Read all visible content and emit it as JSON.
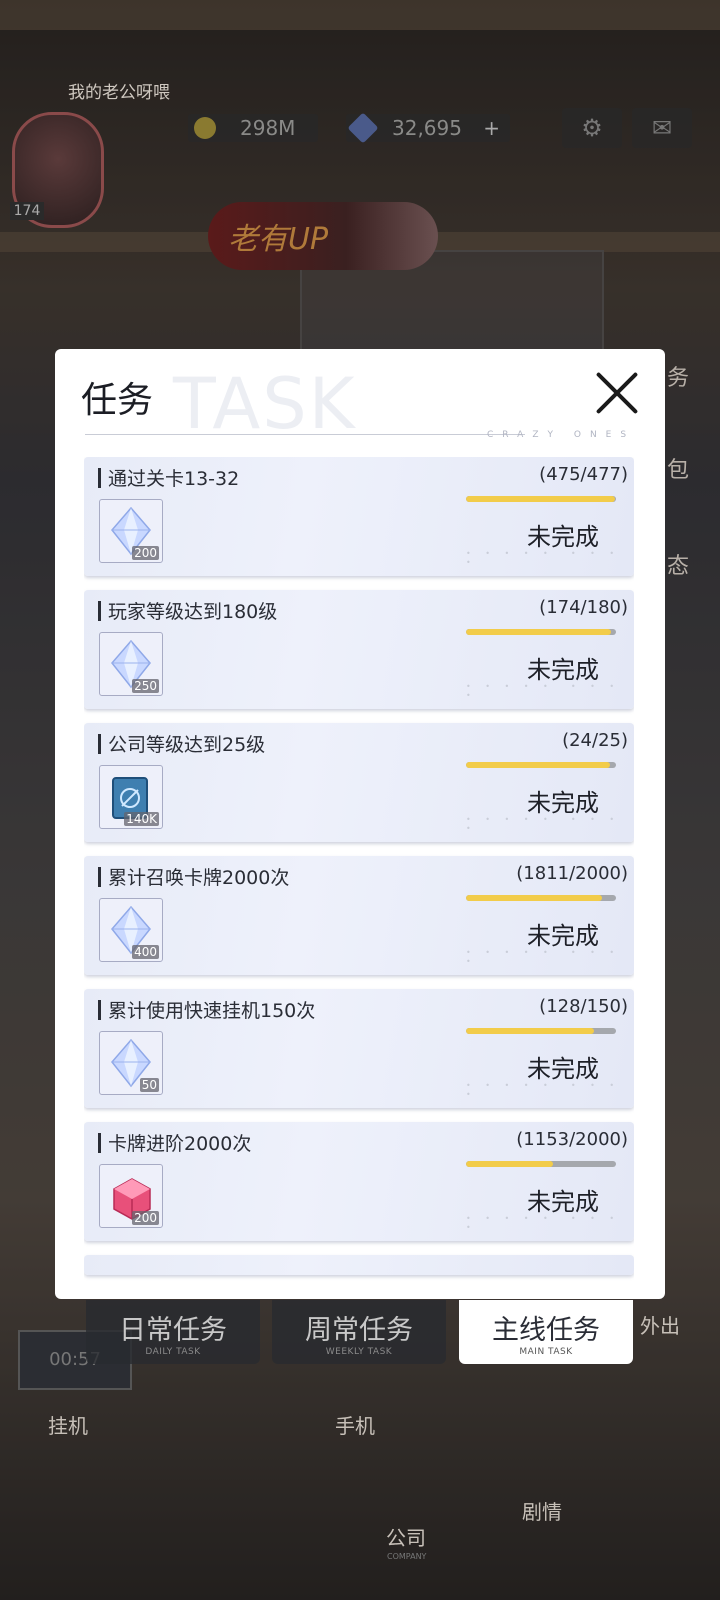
{
  "player": {
    "name": "我的老公呀喂",
    "level": "174"
  },
  "resources": {
    "gold": "298M",
    "diamonds": "32,695",
    "add": "+"
  },
  "banner": {
    "text": "老有UP"
  },
  "colors": {
    "progress_fill": "#f2cc4a",
    "progress_track": "#a5a8ad",
    "modal_bg": "#ffffff"
  },
  "modal": {
    "title": "任务",
    "watermark": "TASK",
    "subtitle_deco": "CRAZY ONES",
    "tasks": [
      {
        "name": "通过关卡13-32",
        "progress": "(475/477)",
        "fraction": 0.996,
        "status": "未完成",
        "reward_icon": "diamond-icon",
        "reward_qty": "200"
      },
      {
        "name": "玩家等级达到180级",
        "progress": "(174/180)",
        "fraction": 0.967,
        "status": "未完成",
        "reward_icon": "diamond-icon",
        "reward_qty": "250"
      },
      {
        "name": "公司等级达到25级",
        "progress": "(24/25)",
        "fraction": 0.96,
        "status": "未完成",
        "reward_icon": "book-icon",
        "reward_qty": "140K"
      },
      {
        "name": "累计召唤卡牌2000次",
        "progress": "(1811/2000)",
        "fraction": 0.906,
        "status": "未完成",
        "reward_icon": "diamond-icon",
        "reward_qty": "400"
      },
      {
        "name": "累计使用快速挂机150次",
        "progress": "(128/150)",
        "fraction": 0.853,
        "status": "未完成",
        "reward_icon": "diamond-icon",
        "reward_qty": "50"
      },
      {
        "name": "卡牌进阶2000次",
        "progress": "(1153/2000)",
        "fraction": 0.577,
        "status": "未完成",
        "reward_icon": "pink-cube-icon",
        "reward_qty": "200"
      }
    ]
  },
  "tabs": [
    {
      "label": "日常任务",
      "sub": "DAILY TASK"
    },
    {
      "label": "周常任务",
      "sub": "WEEKLY TASK"
    },
    {
      "label": "主线任务",
      "sub": "MAIN TASK",
      "active": true
    }
  ],
  "bottom_nav": {
    "idle": "挂机",
    "phone": "手机",
    "company": "公司",
    "story": "剧情",
    "outing": "外出",
    "company_sub": "COMPANY",
    "timer": "00:57"
  },
  "side_labels": {
    "task": "务",
    "bag": "包",
    "state": "态"
  }
}
